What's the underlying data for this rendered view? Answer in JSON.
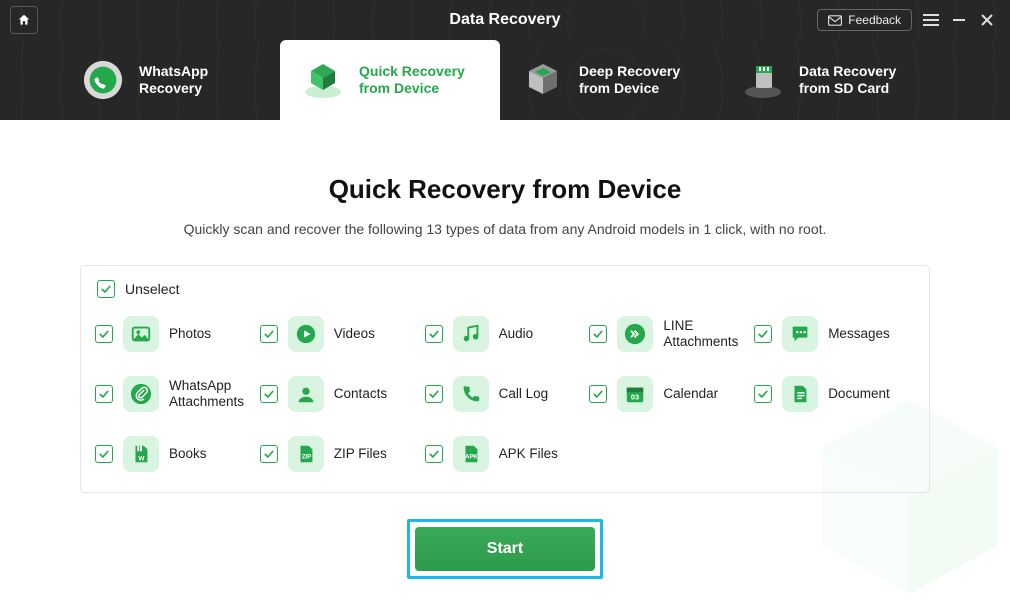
{
  "colors": {
    "accent": "#24a84b",
    "highlight": "#1eb8e6",
    "darkbg": "#272728"
  },
  "header": {
    "title": "Data Recovery",
    "feedback_label": "Feedback"
  },
  "tabs": [
    {
      "id": "whatsapp",
      "label": "WhatsApp Recovery",
      "active": false
    },
    {
      "id": "quick",
      "label": "Quick Recovery from Device",
      "active": true
    },
    {
      "id": "deep",
      "label": "Deep Recovery from Device",
      "active": false
    },
    {
      "id": "sdcard",
      "label": "Data Recovery from SD Card",
      "active": false
    }
  ],
  "main": {
    "page_title": "Quick Recovery from Device",
    "page_sub": "Quickly scan and recover the following 13 types of data from any Android models in 1 click, with no root.",
    "unselect_label": "Unselect",
    "start_label": "Start"
  },
  "data_types": [
    {
      "id": "photos",
      "label": "Photos",
      "checked": true
    },
    {
      "id": "videos",
      "label": "Videos",
      "checked": true
    },
    {
      "id": "audio",
      "label": "Audio",
      "checked": true
    },
    {
      "id": "line",
      "label": "LINE Attachments",
      "checked": true
    },
    {
      "id": "messages",
      "label": "Messages",
      "checked": true
    },
    {
      "id": "waattach",
      "label": "WhatsApp Attachments",
      "checked": true
    },
    {
      "id": "contacts",
      "label": "Contacts",
      "checked": true
    },
    {
      "id": "calllog",
      "label": "Call Log",
      "checked": true
    },
    {
      "id": "calendar",
      "label": "Calendar",
      "checked": true
    },
    {
      "id": "document",
      "label": "Document",
      "checked": true
    },
    {
      "id": "books",
      "label": "Books",
      "checked": true
    },
    {
      "id": "zip",
      "label": "ZIP Files",
      "checked": true
    },
    {
      "id": "apk",
      "label": "APK Files",
      "checked": true
    }
  ]
}
